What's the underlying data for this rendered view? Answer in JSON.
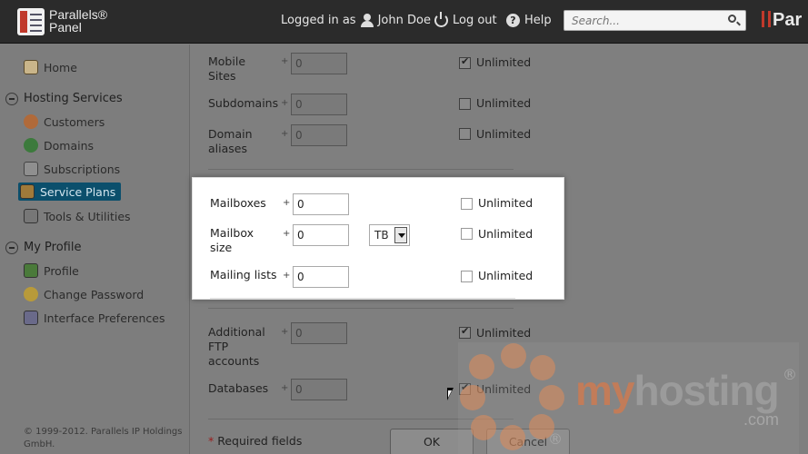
{
  "header": {
    "brand_line1": "Parallels®",
    "brand_line2": "Panel",
    "logged_in_as": "Logged in as",
    "user_name": "John Doe",
    "logout_label": "Log out",
    "help_label": "Help",
    "search_placeholder": "Search...",
    "brand_right": "Par"
  },
  "sidebar": {
    "home": "Home",
    "hosting_section": "Hosting Services",
    "customers": "Customers",
    "domains": "Domains",
    "subscriptions": "Subscriptions",
    "service_plans": "Service Plans",
    "tools": "Tools & Utilities",
    "profile_section": "My Profile",
    "profile": "Profile",
    "change_password": "Change Password",
    "interface_prefs": "Interface Preferences",
    "footer": "© 1999-2012. Parallels IP Holdings GmbH."
  },
  "form": {
    "plus": "+",
    "unlimited": "Unlimited",
    "mobile_sites": {
      "label": "Mobile Sites",
      "value": "0",
      "unlimited": true
    },
    "subdomains": {
      "label": "Subdomains",
      "value": "0",
      "unlimited": false
    },
    "domain_aliases": {
      "label": "Domain aliases",
      "value": "0",
      "unlimited": false
    },
    "mailboxes": {
      "label": "Mailboxes",
      "value": "0",
      "unlimited": false
    },
    "mailbox_size": {
      "label": "Mailbox size",
      "value": "0",
      "unit": "TB",
      "unlimited": false
    },
    "mailing_lists": {
      "label": "Mailing lists",
      "value": "0",
      "unlimited": false
    },
    "additional_ftp": {
      "label": "Additional FTP accounts",
      "value": "0",
      "unlimited": true
    },
    "databases": {
      "label": "Databases",
      "value": "0",
      "unlimited": true
    },
    "required_asterisk": "*",
    "required_text": "Required fields",
    "ok_label": "OK",
    "cancel_label": "Cancel"
  },
  "watermark": {
    "my": "my",
    "hosting": "hosting",
    "com": ".com",
    "reg": "®"
  },
  "colors": {
    "header_bg": "#2b2b2b",
    "active_nav_bg": "#0b4f6c",
    "required_star": "#9b1c1c"
  }
}
